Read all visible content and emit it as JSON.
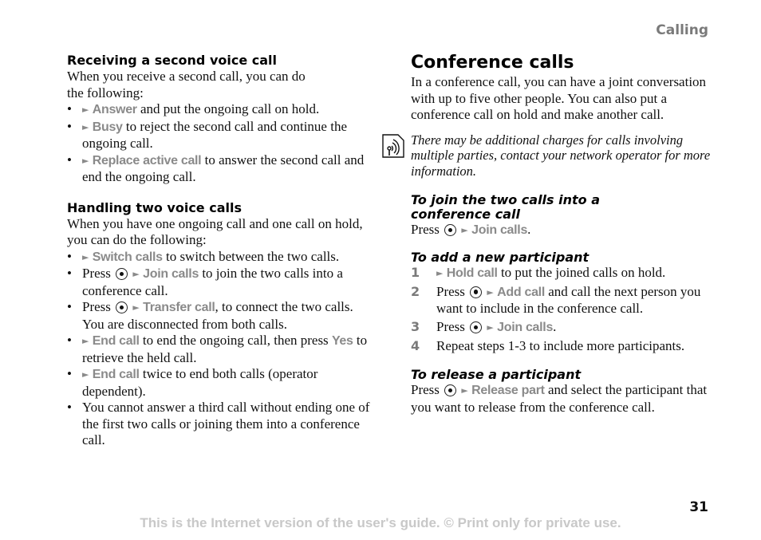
{
  "header": {
    "section_title": "Calling"
  },
  "left": {
    "receiving": {
      "heading": "Receiving a second voice call",
      "intro_line1": "When you receive a second call, you can do",
      "intro_line2": "the following:",
      "items": [
        {
          "menu": "Answer",
          "text": " and put the ongoing call on hold."
        },
        {
          "menu": "Busy",
          "text": " to reject the second call and continue the ongoing call."
        },
        {
          "menu": "Replace active call",
          "text": " to answer the second call and end the ongoing call."
        }
      ]
    },
    "handling": {
      "heading": "Handling two voice calls",
      "intro": "When you have one ongoing call and one call on hold, you can do the following:",
      "items": [
        {
          "menu": "Switch calls",
          "text": " to switch between the two calls."
        },
        {
          "prefix": "Press ",
          "menu": "Join calls",
          "text": " to join the two calls into a conference call."
        },
        {
          "prefix": "Press ",
          "menu": "Transfer call",
          "text": ", to connect the two calls. You are disconnected from both calls."
        },
        {
          "menu": "End call",
          "text": " to end the ongoing call, then press ",
          "menu2": "Yes",
          "text2": " to retrieve the held call."
        },
        {
          "menu": "End call",
          "text": " twice to end both calls (operator dependent)."
        },
        {
          "text": "You cannot answer a third call without ending one of the first two calls or joining them into a conference call."
        }
      ]
    }
  },
  "right": {
    "title": "Conference calls",
    "intro": "In a conference call, you can have a joint conversation with up to five other people. You can also put a conference call on hold and make another call.",
    "note": "There may be additional charges for calls involving multiple parties, contact your network operator for more information.",
    "join": {
      "heading_line1": "To join the two calls into a",
      "heading_line2": "conference call",
      "prefix": "Press ",
      "menu": "Join calls",
      "suffix": "."
    },
    "add": {
      "heading": "To add a new participant",
      "steps": [
        {
          "num": "1",
          "menu": "Hold call",
          "text": " to put the joined calls on hold."
        },
        {
          "num": "2",
          "prefix": "Press ",
          "menu": "Add call",
          "text": " and call the next person you want to include in the conference call."
        },
        {
          "num": "3",
          "prefix": "Press ",
          "menu": "Join calls",
          "text": "."
        },
        {
          "num": "4",
          "text": "Repeat steps 1-3 to include more participants."
        }
      ]
    },
    "release": {
      "heading": "To release a participant",
      "prefix": "Press ",
      "menu": "Release part",
      "text": " and select the participant that you want to release from the conference call."
    }
  },
  "icons": {
    "arrow": "►",
    "bullet": "•"
  },
  "footer": {
    "page_number": "31",
    "notice": "This is the Internet version of the user's guide. © Print only for private use."
  }
}
